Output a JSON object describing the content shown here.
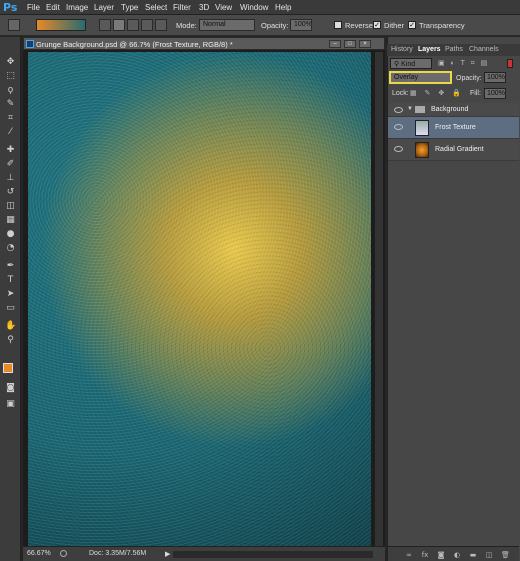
{
  "menu": {
    "logo": "Ps",
    "items": [
      "File",
      "Edit",
      "Image",
      "Layer",
      "Type",
      "Select",
      "Filter",
      "3D",
      "View",
      "Window",
      "Help"
    ]
  },
  "options": {
    "mode_label": "Mode:",
    "mode_value": "Normal",
    "opacity_label": "Opacity:",
    "opacity_value": "100%",
    "reverse_label": "Reverse",
    "dither_label": "Dither",
    "transparency_label": "Transparency",
    "reverse_checked": false,
    "dither_checked": true,
    "transparency_checked": true
  },
  "document": {
    "title": "Grunge Background.psd @ 66.7% (Frost Texture, RGB/8) *"
  },
  "status": {
    "zoom": "66.67%",
    "doc_size": "Doc: 3.35M/7.56M"
  },
  "panel": {
    "tabs": [
      "History",
      "Layers",
      "Paths",
      "Channels"
    ],
    "active_tab": "Layers",
    "kind_label": "Kind",
    "blend_mode": "Overlay",
    "opacity_label": "Opacity:",
    "opacity_value": "100%",
    "lock_label": "Lock:",
    "fill_label": "Fill:",
    "fill_value": "100%",
    "layers": [
      {
        "name": "Background",
        "type": "group"
      },
      {
        "name": "Frost Texture",
        "type": "layer",
        "selected": true
      },
      {
        "name": "Radial Gradient",
        "type": "layer",
        "selected": false
      }
    ]
  },
  "colors": {
    "accent_blue": "#3fa9f5",
    "foreground_swatch": "#e8892a",
    "background_swatch": "#0f3b40",
    "selected_layer": "#5d6e82",
    "blend_highlight": "#e8d84a"
  }
}
